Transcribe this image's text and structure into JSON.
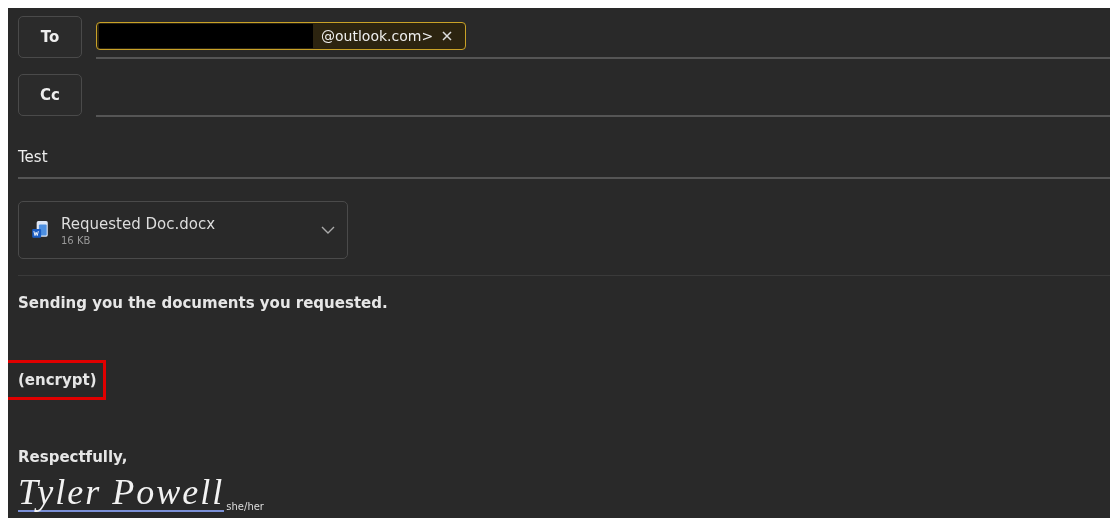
{
  "recipients": {
    "to": {
      "label": "To",
      "chips": [
        {
          "redacted": true,
          "text": "@outlook.com>"
        }
      ]
    },
    "cc": {
      "label": "Cc"
    }
  },
  "subject": {
    "value": "Test"
  },
  "attachment": {
    "name": "Requested Doc.docx",
    "size": "16 KB"
  },
  "body": [
    {
      "text": "Sending you the documents you requested.",
      "highlighted": false
    },
    {
      "text": "(encrypt)",
      "highlighted": true
    },
    {
      "text": "Respectfully,",
      "highlighted": false
    }
  ],
  "signature": {
    "name": "Tyler Powell",
    "pronouns": "she/her"
  }
}
